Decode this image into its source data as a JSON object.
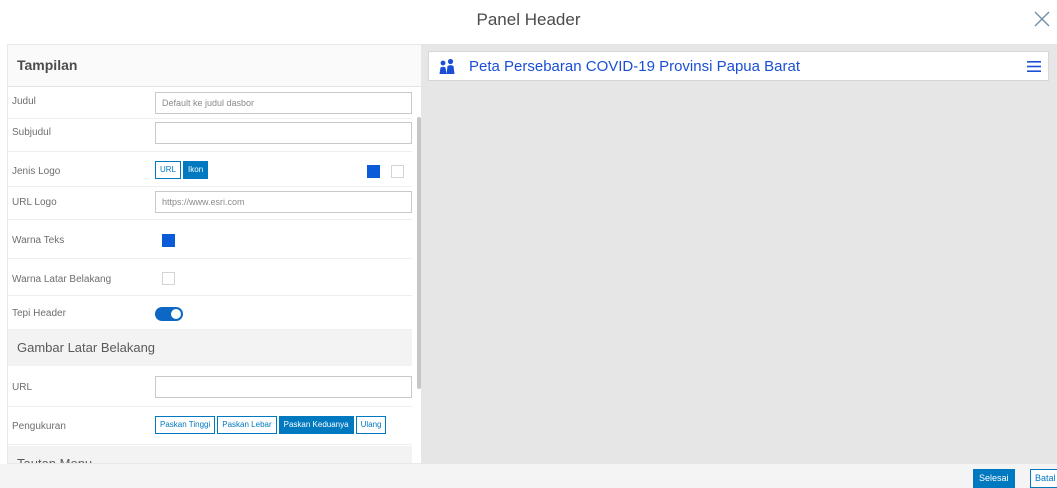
{
  "dialog": {
    "title": "Panel Header"
  },
  "settings": {
    "heading": "Tampilan",
    "fields": {
      "judul_label": "Judul",
      "judul_placeholder": "Default ke judul dasbor",
      "subjudul_label": "Subjudul",
      "subjudul_value": "",
      "jenis_logo_label": "Jenis Logo",
      "jenis_logo_options": [
        "URL",
        "Ikon"
      ],
      "jenis_logo_selected": "Ikon",
      "url_logo_label": "URL Logo",
      "url_logo_value": "https://www.esri.com",
      "warna_teks_label": "Warna Teks",
      "warna_teks_color": "#0a5bd8",
      "warna_latar_label": "Warna Latar Belakang",
      "tepi_header_label": "Tepi Header",
      "tepi_header_on": true
    },
    "background_section": {
      "heading": "Gambar Latar Belakang",
      "url_label": "URL",
      "url_value": "",
      "pengukuran_label": "Pengukuran",
      "pengukuran_options": [
        "Paskan Tinggi",
        "Paskan Lebar",
        "Paskan Keduanya",
        "Ulang"
      ],
      "pengukuran_selected": "Paskan Keduanya"
    },
    "menu_section": {
      "heading": "Tautan Menu"
    }
  },
  "preview": {
    "title": "Peta Persebaran COVID-19 Provinsi Papua Barat",
    "title_color": "#1a4fd6"
  },
  "footer": {
    "done_label": "Selesai",
    "cancel_label": "Batal"
  },
  "colors": {
    "accent": "#0079c1",
    "swatch_blue": "#0a5bd8"
  }
}
